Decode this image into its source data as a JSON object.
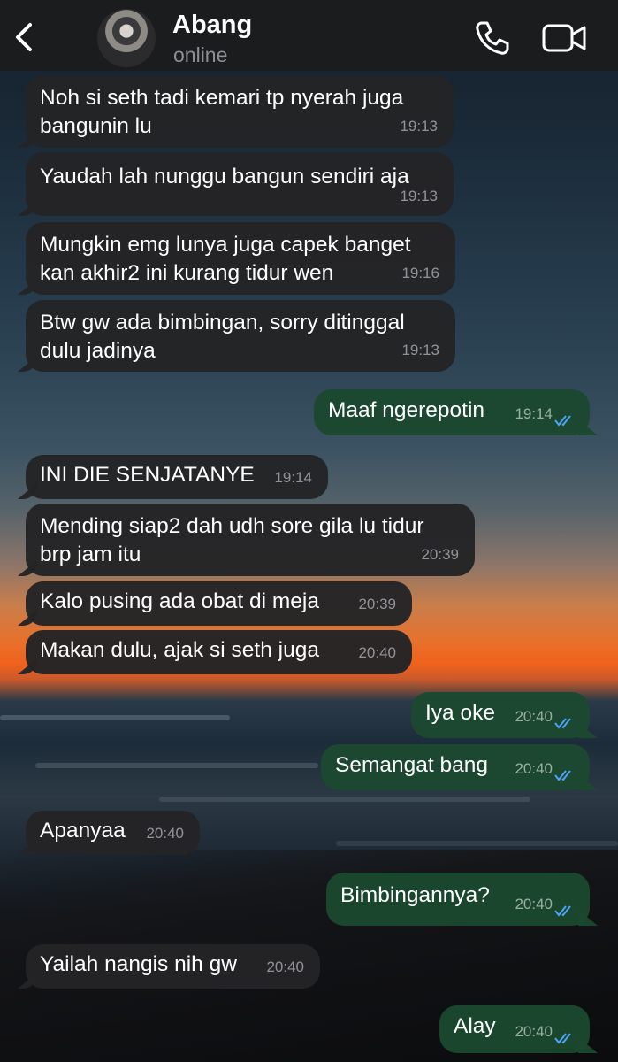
{
  "header": {
    "contact_name": "Abang",
    "status": "online",
    "icons": [
      "chevron-left-icon",
      "avatar",
      "phone-icon",
      "video-camera-icon"
    ]
  },
  "colors": {
    "header_bg": "#1c1c1e",
    "incoming_bubble": "#242426",
    "outgoing_bubble": "#1c4830",
    "read_ticks": "#4fa3f7",
    "status_text": "#8e8e93"
  },
  "messages": [
    {
      "direction": "in",
      "text": "Noh si seth tadi kemari tp nyerah juga\nbangunin lu",
      "time": "19:13"
    },
    {
      "direction": "in",
      "text": "Yaudah lah nunggu bangun sendiri aja",
      "time": "19:13"
    },
    {
      "direction": "in",
      "text": "Mungkin emg lunya juga capek banget\nkan akhir2 ini kurang tidur wen",
      "time": "19:16"
    },
    {
      "direction": "in",
      "text": "Btw gw ada bimbingan, sorry ditinggal\ndulu jadinya",
      "time": "19:13"
    },
    {
      "direction": "out",
      "text": "Maaf ngerepotin",
      "time": "19:14",
      "read": true
    },
    {
      "direction": "in",
      "text": "INI DIE SENJATANYE",
      "time": "19:14"
    },
    {
      "direction": "in",
      "text": "Mending siap2 dah udh sore gila lu tidur\nbrp jam itu",
      "time": "20:39"
    },
    {
      "direction": "in",
      "text": "Kalo pusing ada obat di meja",
      "time": "20:39"
    },
    {
      "direction": "in",
      "text": "Makan dulu, ajak si seth juga",
      "time": "20:40"
    },
    {
      "direction": "out",
      "text": "Iya oke",
      "time": "20:40",
      "read": true
    },
    {
      "direction": "out",
      "text": "Semangat bang",
      "time": "20:40",
      "read": true
    },
    {
      "direction": "in",
      "text": "Apanyaa",
      "time": "20:40"
    },
    {
      "direction": "out",
      "text": "Bimbingannya?",
      "time": "20:40",
      "read": true
    },
    {
      "direction": "in",
      "text": "Yailah nangis nih gw",
      "time": "20:40"
    },
    {
      "direction": "out",
      "text": "Alay",
      "time": "20:40",
      "read": true
    }
  ]
}
